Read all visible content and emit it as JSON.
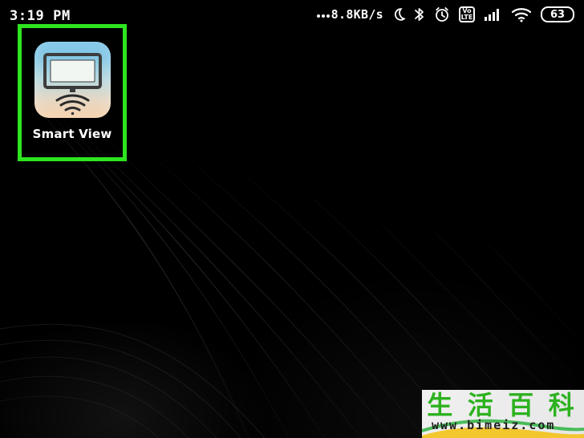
{
  "status_bar": {
    "time": "3:19 PM",
    "network_speed": "8.8KB/s",
    "volte_top": "Vo",
    "volte_bottom": "LTE",
    "battery_level": "63",
    "icons": [
      "dots-icon",
      "moon-icon",
      "bluetooth-icon",
      "alarm-icon",
      "volte-icon",
      "signal-icon",
      "wifi-icon",
      "battery-icon"
    ]
  },
  "home_screen": {
    "apps": [
      {
        "label": "Smart View",
        "icon": "smart-view-icon",
        "highlight_color": "#2ee51f"
      }
    ]
  },
  "watermark": {
    "chinese_text": [
      "生",
      "活",
      "百",
      "科"
    ],
    "url": "www.bimeiz.com",
    "accent_color": "#2db21f"
  }
}
